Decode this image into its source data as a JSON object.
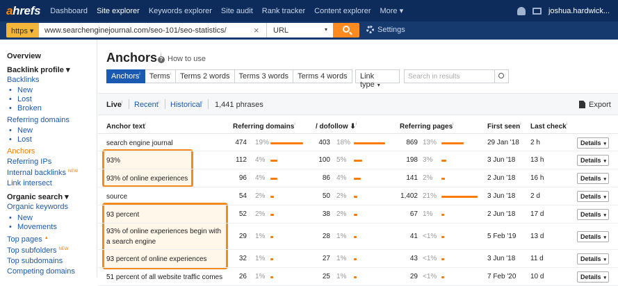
{
  "topnav": {
    "logo_a": "a",
    "logo_rest": "hrefs",
    "items": [
      "Dashboard",
      "Site explorer",
      "Keywords explorer",
      "Site audit",
      "Rank tracker",
      "Content explorer",
      "More ▾"
    ],
    "user": "joshua.hardwick..."
  },
  "search": {
    "protocol": "https ▾",
    "url": "www.searchenginejournal.com/seo-101/seo-statistics/",
    "clear": "×",
    "mode": "URL",
    "mode_caret": "▾",
    "settings": "Settings"
  },
  "sidebar": [
    {
      "label": "Overview",
      "kind": "h"
    },
    {
      "label": "Backlink profile ▾",
      "kind": "h"
    },
    {
      "label": "Backlinks",
      "kind": "l"
    },
    {
      "label": "New",
      "kind": "sub"
    },
    {
      "label": "Lost",
      "kind": "sub"
    },
    {
      "label": "Broken",
      "kind": "sub"
    },
    {
      "label": "Referring domains",
      "kind": "l"
    },
    {
      "label": "New",
      "kind": "sub"
    },
    {
      "label": "Lost",
      "kind": "sub"
    },
    {
      "label": "Anchors",
      "kind": "cur"
    },
    {
      "label": "Referring IPs",
      "kind": "l"
    },
    {
      "label": "Internal backlinks",
      "kind": "l",
      "badge": "NEW"
    },
    {
      "label": "Link intersect",
      "kind": "l"
    },
    {
      "label": "Organic search ▾",
      "kind": "h"
    },
    {
      "label": "Organic keywords",
      "kind": "l"
    },
    {
      "label": "New",
      "kind": "sub"
    },
    {
      "label": "Movements",
      "kind": "sub"
    },
    {
      "label": "Top pages",
      "kind": "l",
      "badge": "▲"
    },
    {
      "label": "Top subfolders",
      "kind": "l",
      "badge": "NEW"
    },
    {
      "label": "Top subdomains",
      "kind": "l"
    },
    {
      "label": "Competing domains",
      "kind": "l"
    }
  ],
  "page": {
    "title": "Anchors",
    "title_sup": "i",
    "howto": "How to use",
    "qmark": "?"
  },
  "tabs": [
    "Anchors",
    "Terms",
    "Terms 2 words",
    "Terms 3 words",
    "Terms 4 words"
  ],
  "tab_sup": "i",
  "linktype": "Link type",
  "linktype_caret": "▾",
  "search_results_placeholder": "Search in results",
  "filter": {
    "live": "Live",
    "recent": "Recent",
    "historical": "Historical",
    "count": "1,441 phrases",
    "export": "Export",
    "sup": "i"
  },
  "columns": {
    "anchor": "Anchor text",
    "refdomains": "Referring domains",
    "dofollow": "/ dofollow ⬇",
    "refpages": "Referring pages",
    "firstseen": "First seen",
    "lastcheck": "Last check",
    "sup": "i"
  },
  "rows": [
    {
      "anchor": "search engine journal",
      "rd": "474",
      "rdp": "19%",
      "rdf": 0.19,
      "df": "403",
      "dfp": "18%",
      "dff": 0.18,
      "rp": "869",
      "rpp": "13%",
      "rpf": 0.13,
      "first": "29 Jan '18",
      "last": "2 h"
    },
    {
      "anchor": "93%",
      "rd": "112",
      "rdp": "4%",
      "rdf": 0.04,
      "df": "100",
      "dfp": "5%",
      "dff": 0.05,
      "rp": "198",
      "rpp": "3%",
      "rpf": 0.03,
      "first": "3 Jun '18",
      "last": "13 h"
    },
    {
      "anchor": "93% of online experiences",
      "rd": "96",
      "rdp": "4%",
      "rdf": 0.04,
      "df": "86",
      "dfp": "4%",
      "dff": 0.04,
      "rp": "141",
      "rpp": "2%",
      "rpf": 0.02,
      "first": "2 Jun '18",
      "last": "16 h"
    },
    {
      "anchor": "source",
      "rd": "54",
      "rdp": "2%",
      "rdf": 0.02,
      "df": "50",
      "dfp": "2%",
      "dff": 0.02,
      "rp": "1,402",
      "rpp": "21%",
      "rpf": 0.21,
      "first": "3 Jun '18",
      "last": "2 d"
    },
    {
      "anchor": "93 percent",
      "rd": "52",
      "rdp": "2%",
      "rdf": 0.02,
      "df": "38",
      "dfp": "2%",
      "dff": 0.02,
      "rp": "67",
      "rpp": "1%",
      "rpf": 0.01,
      "first": "2 Jun '18",
      "last": "17 d"
    },
    {
      "anchor": "93% of online experiences begin with a search engine",
      "rd": "29",
      "rdp": "1%",
      "rdf": 0.01,
      "df": "28",
      "dfp": "1%",
      "dff": 0.01,
      "rp": "41",
      "rpp": "<1%",
      "rpf": 0.005,
      "first": "5 Feb '19",
      "last": "13 d"
    },
    {
      "anchor": "93 percent of online experiences",
      "rd": "32",
      "rdp": "1%",
      "rdf": 0.01,
      "df": "27",
      "dfp": "1%",
      "dff": 0.01,
      "rp": "43",
      "rpp": "<1%",
      "rpf": 0.005,
      "first": "3 Jun '18",
      "last": "11 d"
    },
    {
      "anchor": "51 percent of all website traffic comes",
      "rd": "26",
      "rdp": "1%",
      "rdf": 0.01,
      "df": "25",
      "dfp": "1%",
      "dff": 0.01,
      "rp": "29",
      "rpp": "<1%",
      "rpf": 0.005,
      "first": "7 Feb '20",
      "last": "10 d"
    }
  ],
  "details_label": "Details",
  "details_caret": "▾",
  "colors": {
    "nav": "#0d2c5c",
    "accent": "#ff7b00",
    "link": "#1a5ab1",
    "highlight": "#f28a1e"
  }
}
